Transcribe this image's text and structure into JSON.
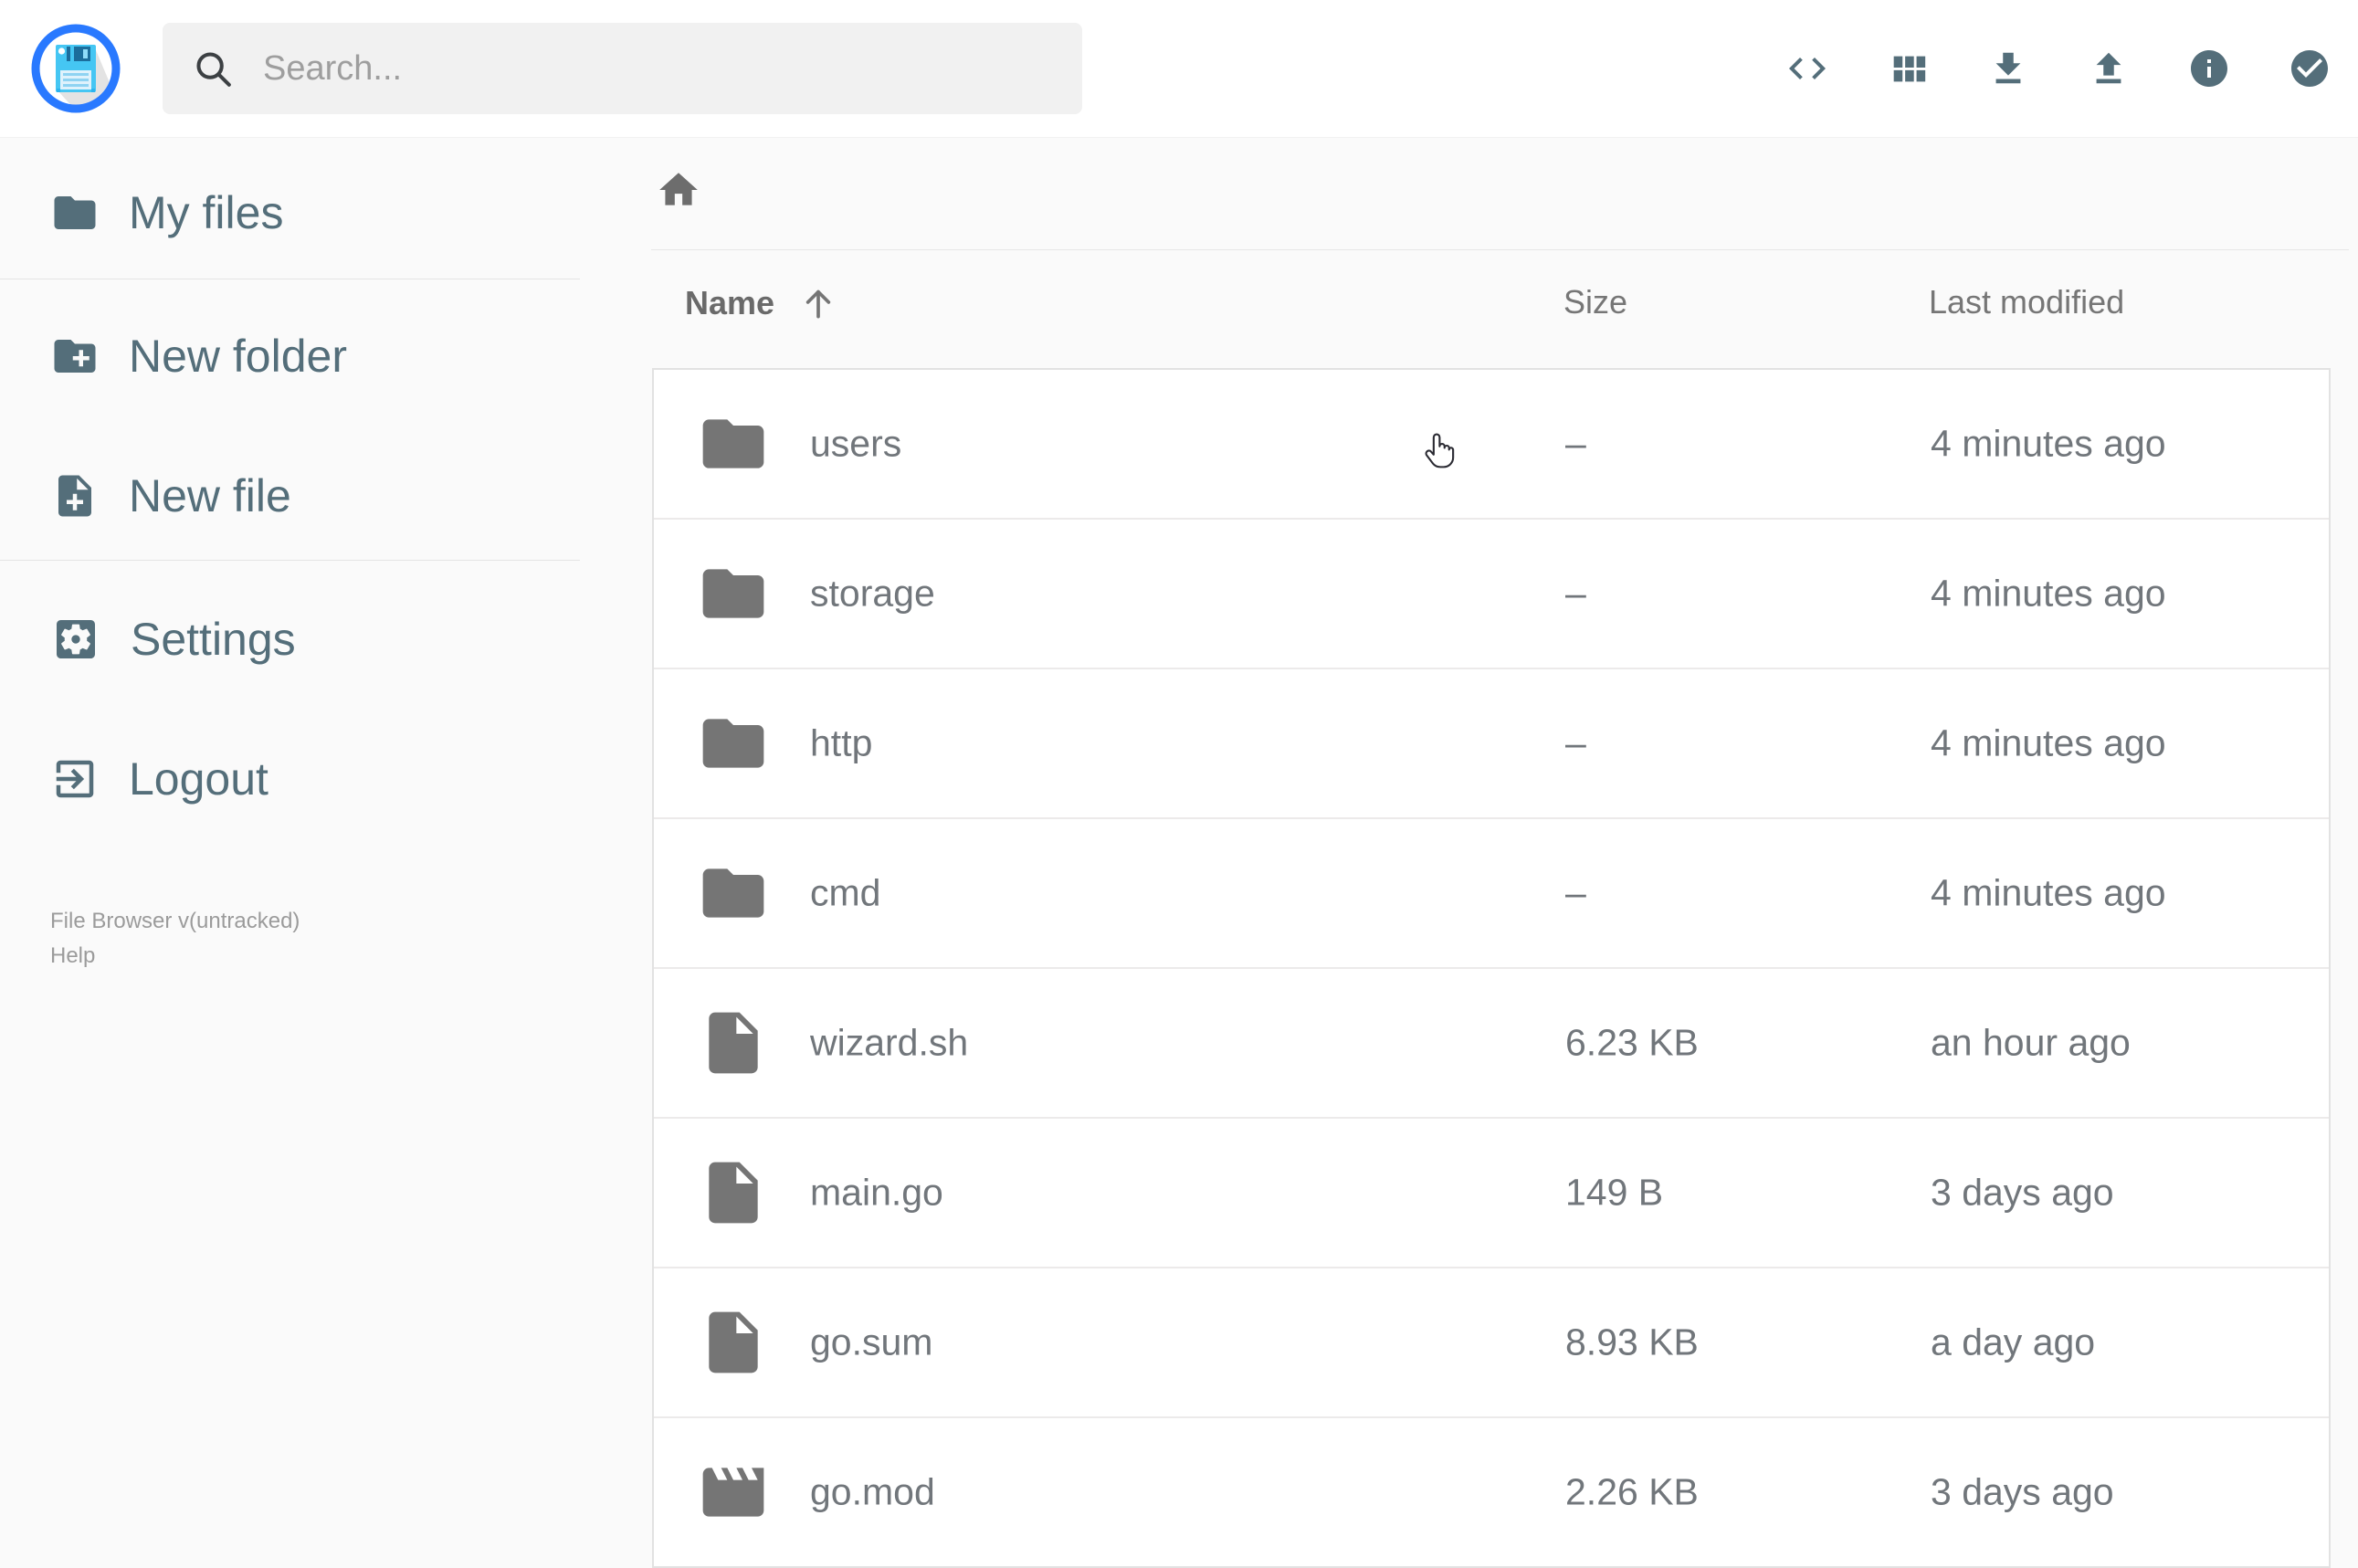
{
  "colors": {
    "accent_blue": "#2979ff",
    "slate": "#546e7a",
    "row_text": "#71767b",
    "page_background": "#fafafa"
  },
  "topbar": {
    "logo_icon": "floppy-disk-logo",
    "search": {
      "placeholder": "Search...",
      "value": "",
      "icon": "search-icon"
    },
    "icons": [
      "code",
      "view-module-grid",
      "download",
      "upload",
      "info",
      "check-circle"
    ]
  },
  "sidebar": {
    "items": [
      {
        "label": "My files",
        "icon": "folder"
      },
      {
        "label": "New folder",
        "icon": "create-new-folder"
      },
      {
        "label": "New file",
        "icon": "note-add"
      },
      {
        "label": "Settings",
        "icon": "settings-applications"
      },
      {
        "label": "Logout",
        "icon": "exit-to-app"
      }
    ],
    "footer": {
      "version_line": "File Browser v(untracked)",
      "help_label": "Help"
    }
  },
  "breadcrumb": {
    "icons": [
      "home"
    ]
  },
  "listing": {
    "columns": [
      {
        "label": "Name",
        "sorted": "asc",
        "sort_icon": "arrow-upward"
      },
      {
        "label": "Size"
      },
      {
        "label": "Last modified"
      }
    ],
    "rows": [
      {
        "name": "users",
        "icon": "folder",
        "size": "–",
        "modified": "4 minutes ago"
      },
      {
        "name": "storage",
        "icon": "folder",
        "size": "–",
        "modified": "4 minutes ago"
      },
      {
        "name": "http",
        "icon": "folder",
        "size": "–",
        "modified": "4 minutes ago"
      },
      {
        "name": "cmd",
        "icon": "folder",
        "size": "–",
        "modified": "4 minutes ago"
      },
      {
        "name": "wizard.sh",
        "icon": "file",
        "size": "6.23 KB",
        "modified": "an hour ago"
      },
      {
        "name": "main.go",
        "icon": "file",
        "size": "149 B",
        "modified": "3 days ago"
      },
      {
        "name": "go.sum",
        "icon": "file",
        "size": "8.93 KB",
        "modified": "a day ago"
      },
      {
        "name": "go.mod",
        "icon": "movie",
        "size": "2.26 KB",
        "modified": "3 days ago"
      }
    ]
  }
}
